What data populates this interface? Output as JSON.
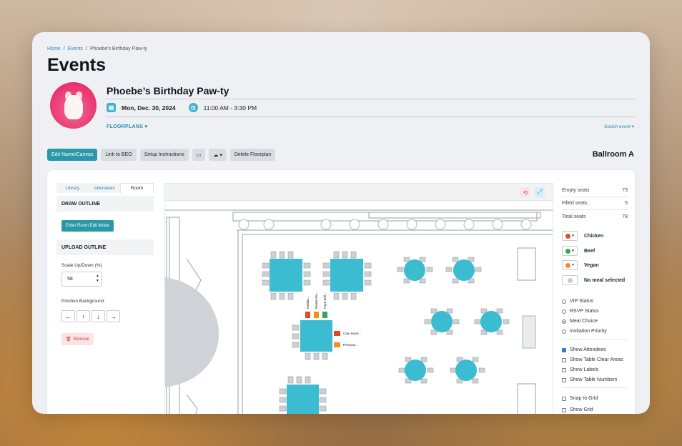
{
  "breadcrumb": {
    "home": "Home",
    "events": "Events",
    "current": "Phoebe's Birthday Paw-ty"
  },
  "page_title": "Events",
  "event": {
    "name": "Phoebe’s Birthday Paw-ty",
    "date": "Mon, Dec. 30, 2024",
    "time": "11:00 AM - 3:30 PM"
  },
  "nav": {
    "floorplans": "FLOORPLANS",
    "switch_event": "Switch event"
  },
  "toolbar": {
    "edit_name": "Edit Name/Canvas",
    "link_beo": "Link to BEO",
    "setup": "Setup Instructions",
    "delete": "Delete Floorplan"
  },
  "room_name": "Ballroom A",
  "left_panel": {
    "tabs": [
      "Library",
      "Attendees",
      "Room"
    ],
    "draw_outline": "DRAW OUTLINE",
    "enter_room_edit": "Enter Room Edit Mode",
    "upload_outline": "UPLOAD OUTLINE",
    "scale_label": "Scale Up/Down (%)",
    "scale_value": "58",
    "position_label": "Position Background",
    "remove": "Remove"
  },
  "stats": [
    {
      "label": "Empty seats",
      "value": "73"
    },
    {
      "label": "Filled seats",
      "value": "5"
    },
    {
      "label": "Total seats",
      "value": "78"
    }
  ],
  "meals": [
    {
      "label": "Chicken",
      "color": "#e04a2a"
    },
    {
      "label": "Beef",
      "color": "#34a853"
    },
    {
      "label": "Vegan",
      "color": "#f0901e"
    },
    {
      "label": "No meal selected",
      "color": "#c9cdd3"
    }
  ],
  "view_options": [
    {
      "label": "VIP Status",
      "selected": false
    },
    {
      "label": "RSVP Status",
      "selected": false
    },
    {
      "label": "Meal Choice",
      "selected": true
    },
    {
      "label": "Invitation Priority",
      "selected": false
    }
  ],
  "show_options": [
    {
      "label": "Show Attendees",
      "checked": true
    },
    {
      "label": "Show Table Clear Areas",
      "checked": false
    },
    {
      "label": "Show Labels",
      "checked": false
    },
    {
      "label": "Show Table Numbers",
      "checked": false
    }
  ],
  "grid_options": [
    {
      "label": "Snap to Grid",
      "checked": false
    },
    {
      "label": "Show Grid",
      "checked": false
    }
  ],
  "canvas": {
    "attendee_labels_top": [
      "Kaitlan...",
      "Remie Ma...",
      "Paya Bell..."
    ],
    "attendee_labels_side": [
      "Cate Hane...",
      "Princess..."
    ],
    "table_color": "#3bbcd0"
  }
}
